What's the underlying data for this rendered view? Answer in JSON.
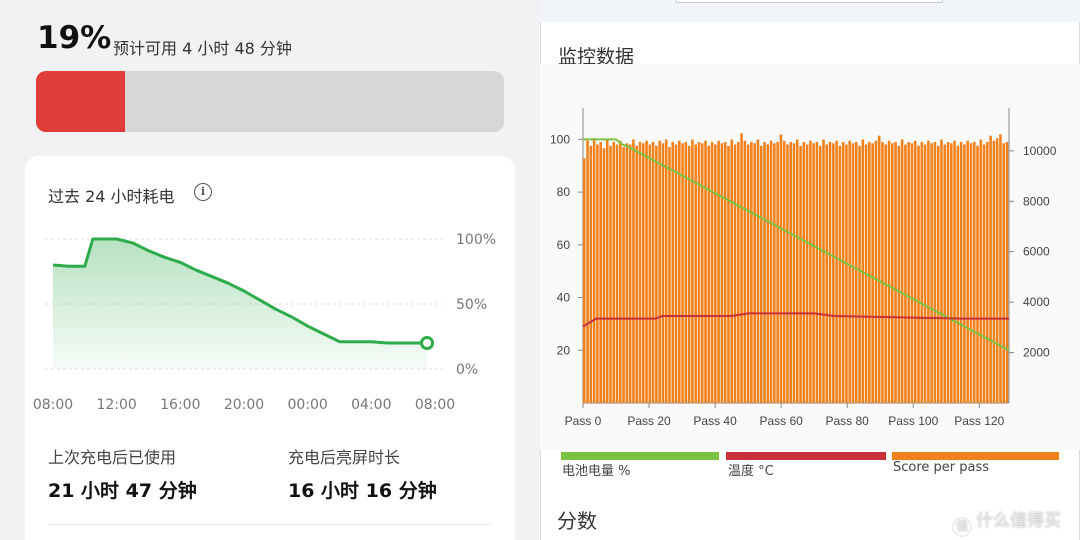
{
  "battery": {
    "percent": "19%",
    "estimate": "预计可用 4 小时 48 分钟",
    "level_fraction": 0.19,
    "color": "#e03c3a"
  },
  "usage_card": {
    "title": "过去 24 小时耗电",
    "info_icon": "info-icon",
    "x_ticks": [
      "08:00",
      "12:00",
      "16:00",
      "20:00",
      "00:00",
      "04:00",
      "08:00"
    ],
    "y_ticks": [
      "100%",
      "50%",
      "0%"
    ],
    "line_color": "#2eab4b",
    "series_x_hours": [
      0,
      1,
      2,
      2.5,
      3,
      4,
      5,
      6,
      7,
      8,
      9,
      10,
      11,
      12,
      13,
      14,
      15,
      16,
      17,
      18,
      19,
      20,
      21,
      22,
      23.5
    ],
    "series_values": [
      80,
      79,
      79,
      100,
      100,
      100,
      97,
      91,
      86,
      82,
      76,
      71,
      66,
      60,
      53,
      46,
      40,
      33,
      27,
      21,
      21,
      21,
      20,
      20,
      20
    ],
    "stats": [
      {
        "label": "上次充电后已使用",
        "value": "21 小时 47 分钟"
      },
      {
        "label": "充电后亮屏时长",
        "value": "16 小时 16 分钟"
      }
    ]
  },
  "monitor_panel": {
    "title": "监控数据",
    "section_title": "分数",
    "chart_data": {
      "type": "bar",
      "x_tick_labels": [
        "Pass 0",
        "Pass 20",
        "Pass 40",
        "Pass 60",
        "Pass 80",
        "Pass 100",
        "Pass 120"
      ],
      "x_range": [
        0,
        129
      ],
      "y_left_range": [
        0,
        110
      ],
      "y_left_ticks": [
        "100",
        "80",
        "60",
        "40",
        "20"
      ],
      "y_right_range": [
        0,
        11500
      ],
      "y_right_ticks": [
        "10000",
        "8000",
        "6000",
        "4000",
        "2000"
      ],
      "grid": true,
      "legend_placement": "bottom",
      "series": [
        {
          "name": "电池电量 %",
          "kind": "line",
          "axis": "left",
          "color": "#7cc242",
          "x": [
            0,
            10,
            12,
            14,
            129
          ],
          "y": [
            100,
            100,
            98,
            97,
            20
          ]
        },
        {
          "name": "温度 °C",
          "kind": "line",
          "axis": "left",
          "color": "#c8303a",
          "x": [
            0,
            4,
            22,
            24,
            30,
            45,
            50,
            70,
            76,
            115,
            129
          ],
          "y": [
            29,
            32,
            32,
            33,
            33,
            33,
            34,
            34,
            33,
            32,
            32
          ]
        },
        {
          "name": "Score per pass",
          "kind": "bar",
          "axis": "right",
          "color": "#f2801b",
          "count": 130,
          "values": [
            9700,
            10400,
            10200,
            10500,
            10250,
            10350,
            10100,
            10450,
            10200,
            10350,
            10250,
            10400,
            10150,
            10300,
            10250,
            10450,
            10200,
            10350,
            10300,
            10400,
            10250,
            10350,
            10200,
            10400,
            10300,
            10450,
            10150,
            10350,
            10250,
            10400,
            10300,
            10350,
            10200,
            10450,
            10250,
            10350,
            10300,
            10400,
            10200,
            10350,
            10250,
            10400,
            10300,
            10350,
            10200,
            10450,
            10250,
            10350,
            10700,
            10400,
            10250,
            10350,
            10300,
            10450,
            10200,
            10350,
            10250,
            10400,
            10300,
            10350,
            10650,
            10400,
            10250,
            10350,
            10300,
            10450,
            10200,
            10350,
            10250,
            10400,
            10300,
            10350,
            10200,
            10450,
            10250,
            10350,
            10300,
            10400,
            10200,
            10350,
            10250,
            10400,
            10300,
            10350,
            10200,
            10450,
            10250,
            10350,
            10300,
            10400,
            10600,
            10350,
            10250,
            10400,
            10300,
            10350,
            10200,
            10450,
            10250,
            10350,
            10300,
            10400,
            10200,
            10350,
            10250,
            10400,
            10300,
            10350,
            10200,
            10450,
            10250,
            10350,
            10300,
            10400,
            10200,
            10350,
            10250,
            10400,
            10300,
            10350,
            10200,
            10450,
            10250,
            10350,
            10600,
            10400,
            10500,
            10650,
            10300,
            10350
          ]
        }
      ]
    }
  },
  "watermark": {
    "text": "什么值得买",
    "icon": "值"
  }
}
